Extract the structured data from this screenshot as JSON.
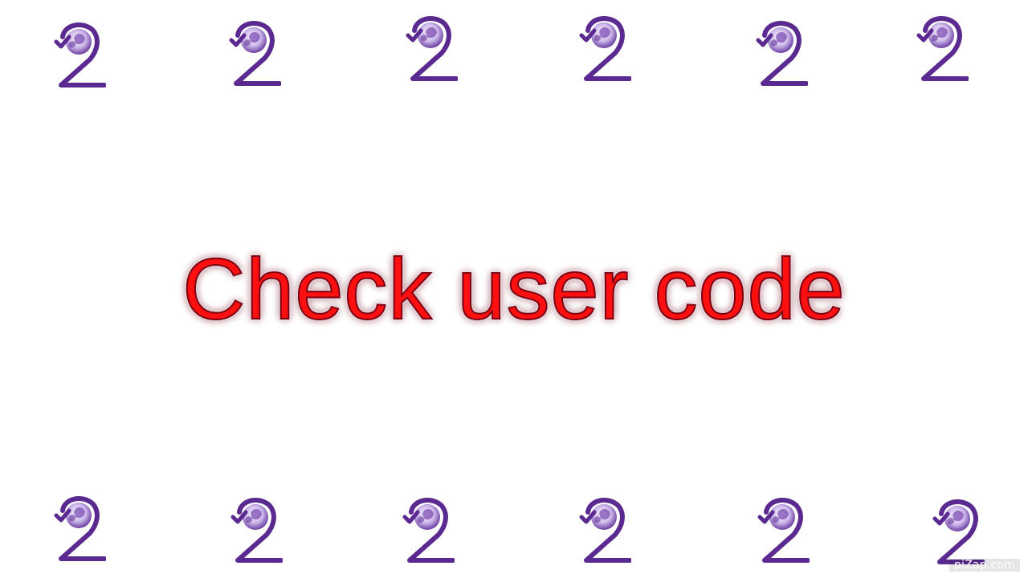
{
  "headline": {
    "text": "Check user code"
  },
  "watermark": {
    "text": "piZap.com"
  },
  "logo": {
    "icon": "globe-arrow-2-icon",
    "primary_color": "#5b2a91",
    "globe_color": "#7b4bb3"
  }
}
